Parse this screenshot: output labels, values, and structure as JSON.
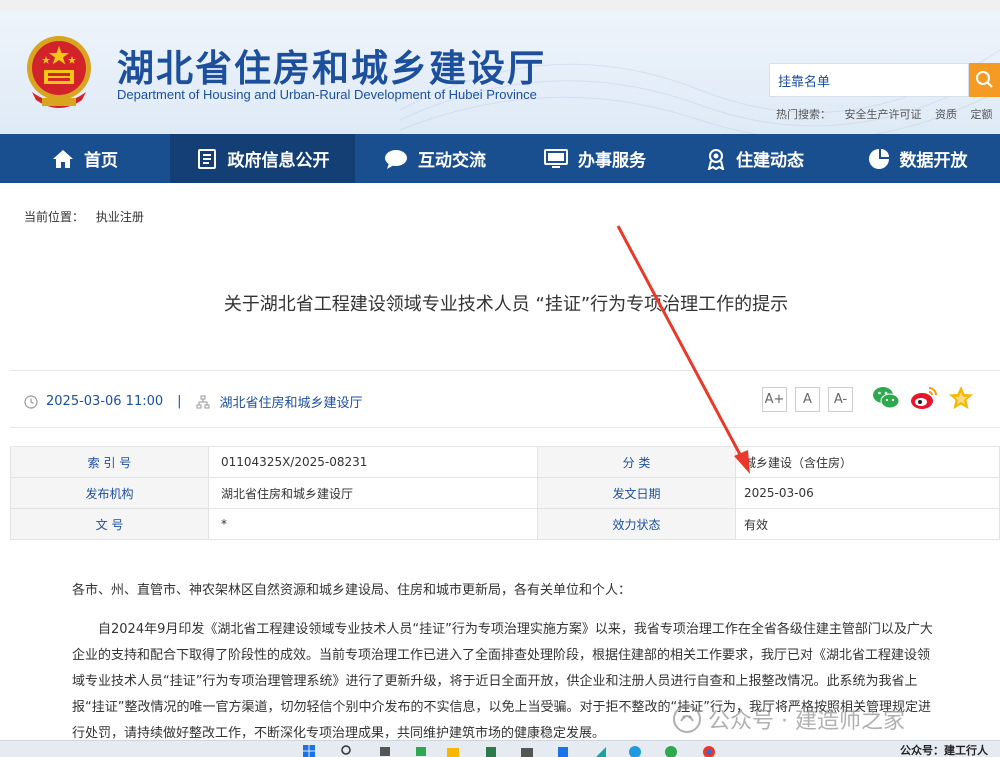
{
  "site": {
    "title": "湖北省住房和城乡建设厅",
    "subtitle": "Department of Housing and Urban-Rural Development of Hubei Province"
  },
  "search": {
    "value": "挂靠名单",
    "hot_label": "热门搜索：",
    "hot_terms": [
      "安全生产许可证",
      "资质",
      "定额"
    ]
  },
  "nav": {
    "items": [
      {
        "label": "首页",
        "icon": "home-icon"
      },
      {
        "label": "政府信息公开",
        "icon": "document-list-icon"
      },
      {
        "label": "互动交流",
        "icon": "chat-bubble-icon"
      },
      {
        "label": "办事服务",
        "icon": "monitor-icon"
      },
      {
        "label": "住建动态",
        "icon": "award-icon"
      },
      {
        "label": "数据开放",
        "icon": "pie-chart-icon"
      }
    ],
    "active_index": 1
  },
  "breadcrumb": {
    "label": "当前位置：",
    "current": "执业注册"
  },
  "article": {
    "title": "关于湖北省工程建设领域专业技术人员 “挂证”行为专项治理工作的提示",
    "datetime": "2025-03-06 11:00",
    "publisher": "湖北省住房和城乡建设厅",
    "font_sizes": [
      "A+",
      "A",
      "A-"
    ],
    "share": [
      "wechat-icon",
      "weibo-icon",
      "favorite-star-icon"
    ]
  },
  "info_table": {
    "rows": [
      {
        "label1": "索 引 号",
        "value1": "01104325X/2025-08231",
        "label2": "分    类",
        "value2": "城乡建设（含住房）"
      },
      {
        "label1": "发布机构",
        "value1": "湖北省住房和城乡建设厅",
        "label2": "发文日期",
        "value2": "2025-03-06"
      },
      {
        "label1": "文    号",
        "value1": "*",
        "label2": "效力状态",
        "value2": "有效"
      }
    ]
  },
  "body": {
    "greeting": "各市、州、直管市、神农架林区自然资源和城乡建设局、住房和城市更新局，各有关单位和个人：",
    "paragraph1": "自2024年9月印发《湖北省工程建设领域专业技术人员“挂证”行为专项治理实施方案》以来，我省专项治理工作在全省各级住建主管部门以及广大企业的支持和配合下取得了阶段性的成效。当前专项治理工作已进入了全面排查处理阶段，根据住建部的相关工作要求，我厅已对《湖北省工程建设领域专业技术人员“挂证”行为专项治理管理系统》进行了更新升级，将于近日全面开放，供企业和注册人员进行自查和上报整改情况。此系统为我省上报“挂证”整改情况的唯一官方渠道，切勿轻信个别中介发布的不实信息，以免上当受骗。对于拒不整改的“挂证”行为，我厅将严格按照相关管理规定进行处罚，请持续做好整改工作，不断深化专项治理成果，共同维护建筑市场的健康稳定发展。"
  },
  "watermark": {
    "text": "公众号 · 建造师之家"
  },
  "taskbar": {
    "text": "公众号：建工行人"
  },
  "colors": {
    "brand_blue": "#1c4f9c",
    "nav_blue": "#1a4f8f",
    "nav_active": "#143f74",
    "search_orange": "#f59a23",
    "arrow_red": "#e8392b"
  }
}
